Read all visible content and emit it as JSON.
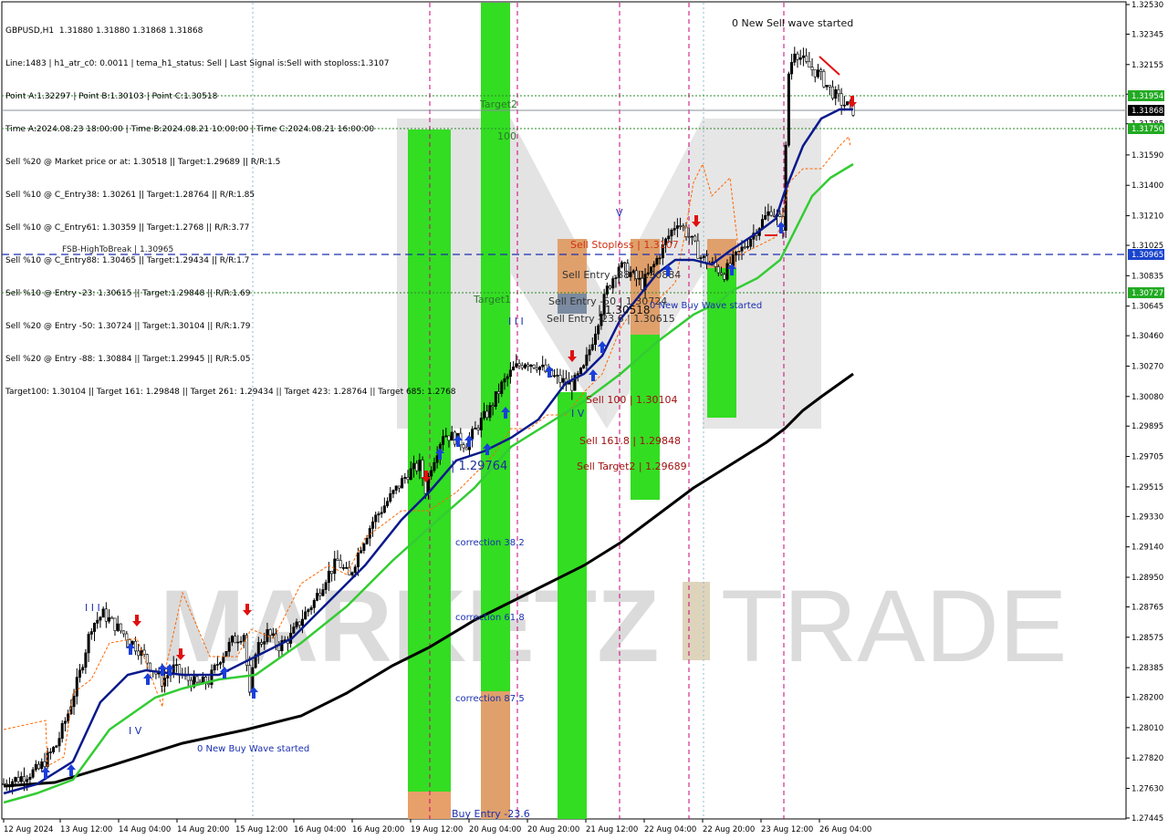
{
  "header": {
    "symbol": "GBPUSD,H1",
    "ohlc": "1.31880 1.31880 1.31868 1.31868",
    "lines": [
      "Line:1483 | h1_atr_c0: 0.0011 | tema_h1_status: Sell | Last Signal is:Sell with stoploss:1.3107",
      "Point A:1.32297 | Point B:1.30103 | Point C:1.30518",
      "Time A:2024.08.23 18:00:00 | Time B:2024.08.21 10:00:00 | Time C:2024.08.21 16:00:00",
      "Sell %20 @ Market price or at: 1.30518 || Target:1.29689 || R/R:1.5",
      "Sell %10 @ C_Entry38: 1.30261 || Target:1.28764 || R/R:1.85",
      "Sell %10 @ C_Entry61: 1.30359 || Target:1.2768 || R/R:3.77",
      "Sell %10 @ C_Entry88: 1.30465 || Target:1.29434 || R/R:1.7",
      "Sell %10 @ Entry -23: 1.30615 || Target:1.29848 || R/R:1.69",
      "Sell %20 @ Entry -50: 1.30724 || Target:1.30104 || R/R:1.79",
      "Sell %20 @ Entry -88: 1.30884 || Target:1.29945 || R/R:5.05",
      "Target100: 1.30104 || Target 161: 1.29848 || Target 261: 1.29434 || Target 423: 1.28764 || Target 685: 1.2768"
    ]
  },
  "watermark": {
    "left": "MARKETZ",
    "right": "TRADE"
  },
  "colors": {
    "green_zone": "#33dd22",
    "orange_zone": "#e0a06b",
    "blue_line": "#0a1a8c",
    "green_line": "#33cc33",
    "black_line": "#000000",
    "orange_line": "#ff6600",
    "magenta_vline": "#cc0077",
    "buy_arrow": "#1a3fd9",
    "sell_arrow": "#e01010",
    "text_dark_red": "#a01010",
    "price_tag_green": "#22aa22",
    "price_tag_blue": "#1a44cc"
  },
  "annotations": {
    "fsb_label": "FSB-HighToBreak | 1.30965",
    "target2": "Target2",
    "target1": "Target1",
    "level_100": "100",
    "sell_stoploss": "Sell Stoploss | 1.3107",
    "sell_entry_88": "Sell Entry -88 | 1.30884",
    "sell_entry_50": "Sell Entry -50 | 1.30724",
    "sell_entry_23": "Sell Entry -23.6 | 1.30615",
    "sell_100": "Sell 100 | 1.30104",
    "sell_161": "Sell 161.8 | 1.29848",
    "sell_target2": "Sell Target2 | 1.29689",
    "price_1_29764": "| 1.29764",
    "price_1_30518": "| 1.30518",
    "correction_38": "correction 38.2",
    "correction_61": "correction 61.8",
    "correction_87": "correction 87.5",
    "buy_entry": "Buy Entry -23.6",
    "new_buy_wave_1": "0 New Buy Wave started",
    "new_buy_wave_2": "0 New Buy Wave started",
    "new_sell_wave": "0 New Sell wave started",
    "roman_3_a": "I I I",
    "roman_3_b": "I I I",
    "roman_4_a": "I V",
    "roman_4_b": "I V",
    "roman_5": "V"
  },
  "price_tags": {
    "p1": "1.31954",
    "p2": "1.31868",
    "p3": "1.31750",
    "p4": "1.30965",
    "p5": "1.30727"
  },
  "chart_data": {
    "type": "candlestick",
    "symbol": "GBPUSD",
    "timeframe": "H1",
    "ylim": [
      1.27445,
      1.3253
    ],
    "y_ticks": [
      "1.32530",
      "1.32345",
      "1.32155",
      "1.31970",
      "1.31785",
      "1.31590",
      "1.31400",
      "1.31210",
      "1.31025",
      "1.30835",
      "1.30645",
      "1.30460",
      "1.30270",
      "1.30080",
      "1.29895",
      "1.29705",
      "1.29515",
      "1.29330",
      "1.29140",
      "1.28950",
      "1.28765",
      "1.28575",
      "1.28385",
      "1.28200",
      "1.28010",
      "1.27820",
      "1.27630",
      "1.27445"
    ],
    "x_ticks": [
      "12 Aug 2024",
      "13 Aug 12:00",
      "14 Aug 04:00",
      "14 Aug 20:00",
      "15 Aug 12:00",
      "16 Aug 04:00",
      "16 Aug 20:00",
      "19 Aug 12:00",
      "20 Aug 04:00",
      "20 Aug 20:00",
      "21 Aug 12:00",
      "22 Aug 04:00",
      "22 Aug 20:00",
      "23 Aug 12:00",
      "26 Aug 04:00"
    ],
    "horizontal_levels": [
      {
        "price": 1.31954,
        "style": "dotted",
        "color": "green"
      },
      {
        "price": 1.31868,
        "style": "solid",
        "color": "gray"
      },
      {
        "price": 1.3175,
        "style": "dotted",
        "color": "green"
      },
      {
        "price": 1.30965,
        "style": "dashed",
        "color": "blue"
      },
      {
        "price": 1.30727,
        "style": "dotted",
        "color": "green"
      }
    ],
    "close_path": [
      [
        0,
        1.2766
      ],
      [
        6,
        1.277
      ],
      [
        12,
        1.2775
      ],
      [
        18,
        1.279
      ],
      [
        22,
        1.281
      ],
      [
        26,
        1.2835
      ],
      [
        30,
        1.2865
      ],
      [
        34,
        1.2872
      ],
      [
        38,
        1.2865
      ],
      [
        42,
        1.2858
      ],
      [
        46,
        1.285
      ],
      [
        50,
        1.284
      ],
      [
        54,
        1.283
      ],
      [
        58,
        1.2838
      ],
      [
        62,
        1.2832
      ],
      [
        66,
        1.2828
      ],
      [
        70,
        1.283
      ],
      [
        74,
        1.2845
      ],
      [
        78,
        1.2855
      ],
      [
        82,
        1.286
      ],
      [
        84,
        1.282
      ],
      [
        86,
        1.285
      ],
      [
        90,
        1.286
      ],
      [
        94,
        1.2852
      ],
      [
        98,
        1.2858
      ],
      [
        102,
        1.287
      ],
      [
        106,
        1.288
      ],
      [
        110,
        1.2895
      ],
      [
        114,
        1.2905
      ],
      [
        118,
        1.2895
      ],
      [
        122,
        1.2915
      ],
      [
        126,
        1.293
      ],
      [
        130,
        1.294
      ],
      [
        134,
        1.295
      ],
      [
        138,
        1.296
      ],
      [
        142,
        1.2965
      ],
      [
        144,
        1.295
      ],
      [
        146,
        1.2965
      ],
      [
        150,
        1.2985
      ],
      [
        154,
        1.2982
      ],
      [
        158,
        1.2978
      ],
      [
        162,
        1.299
      ],
      [
        166,
        1.3
      ],
      [
        170,
        1.3015
      ],
      [
        174,
        1.3025
      ],
      [
        178,
        1.303
      ],
      [
        182,
        1.3028
      ],
      [
        186,
        1.3022
      ],
      [
        190,
        1.3018
      ],
      [
        194,
        1.3015
      ],
      [
        198,
        1.3025
      ],
      [
        202,
        1.305
      ],
      [
        206,
        1.3075
      ],
      [
        210,
        1.309
      ],
      [
        214,
        1.3085
      ],
      [
        218,
        1.3078
      ],
      [
        222,
        1.309
      ],
      [
        226,
        1.3105
      ],
      [
        230,
        1.3118
      ],
      [
        234,
        1.3108
      ],
      [
        238,
        1.3095
      ],
      [
        242,
        1.309
      ],
      [
        246,
        1.3085
      ],
      [
        250,
        1.3095
      ],
      [
        254,
        1.3105
      ],
      [
        258,
        1.3115
      ],
      [
        262,
        1.3125
      ],
      [
        266,
        1.3115
      ],
      [
        268,
        1.321
      ],
      [
        270,
        1.3225
      ],
      [
        274,
        1.3215
      ],
      [
        278,
        1.321
      ],
      [
        282,
        1.32
      ],
      [
        286,
        1.3192
      ],
      [
        290,
        1.3187
      ]
    ]
  }
}
